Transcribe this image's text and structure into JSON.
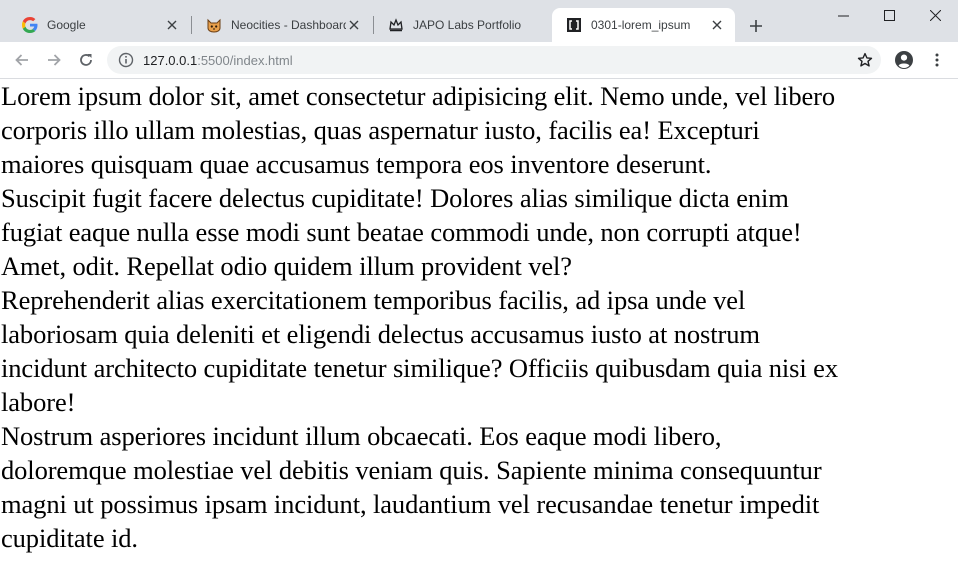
{
  "window": {
    "controls": {
      "minimize": "minimize-icon",
      "maximize": "maximize-icon",
      "close": "close-icon"
    }
  },
  "tabs": [
    {
      "title": "Google",
      "icon": "google-g-icon",
      "active": false
    },
    {
      "title": "Neocities - Dashboard",
      "icon": "neocities-cat-icon",
      "active": false
    },
    {
      "title": "JAPO Labs Portfolio",
      "icon": "japo-crown-icon",
      "active": false
    },
    {
      "title": "0301-lorem_ipsum",
      "icon": "brackets-page-icon",
      "active": true
    }
  ],
  "toolbar": {
    "url_host": "127.0.0.1",
    "url_rest": ":5500/index.html",
    "icons": [
      "back-arrow-icon",
      "forward-arrow-icon",
      "reload-icon",
      "info-icon",
      "star-icon",
      "account-icon",
      "menu-dots-icon"
    ]
  },
  "page": {
    "paragraphs": [
      {
        "lines": [
          "Lorem ipsum dolor sit, amet consectetur adipisicing elit. Nemo unde, vel libero",
          "corporis illo ullam molestias, quas aspernatur iusto, facilis ea! Excepturi",
          "maiores quisquam quae accusamus tempora eos inventore deserunt."
        ]
      },
      {
        "lines": [
          "Suscipit fugit facere delectus cupiditate! Dolores alias similique dicta enim",
          "fugiat eaque nulla esse modi sunt beatae commodi unde, non corrupti atque!",
          "Amet, odit. Repellat odio quidem illum provident vel?"
        ]
      },
      {
        "lines": [
          "Reprehenderit alias exercitationem temporibus facilis, ad ipsa unde vel",
          "laboriosam quia deleniti et eligendi delectus accusamus iusto at nostrum",
          "incidunt architecto cupiditate tenetur similique? Officiis quibusdam quia nisi ex",
          "labore!"
        ]
      },
      {
        "lines": [
          "Nostrum asperiores incidunt illum obcaecati. Eos eaque modi libero,",
          "doloremque molestiae vel debitis veniam quis. Sapiente minima consequuntur",
          "magni ut possimus ipsam incidunt, laudantium vel recusandae tenetur impedit",
          "cupiditate id."
        ]
      }
    ]
  }
}
